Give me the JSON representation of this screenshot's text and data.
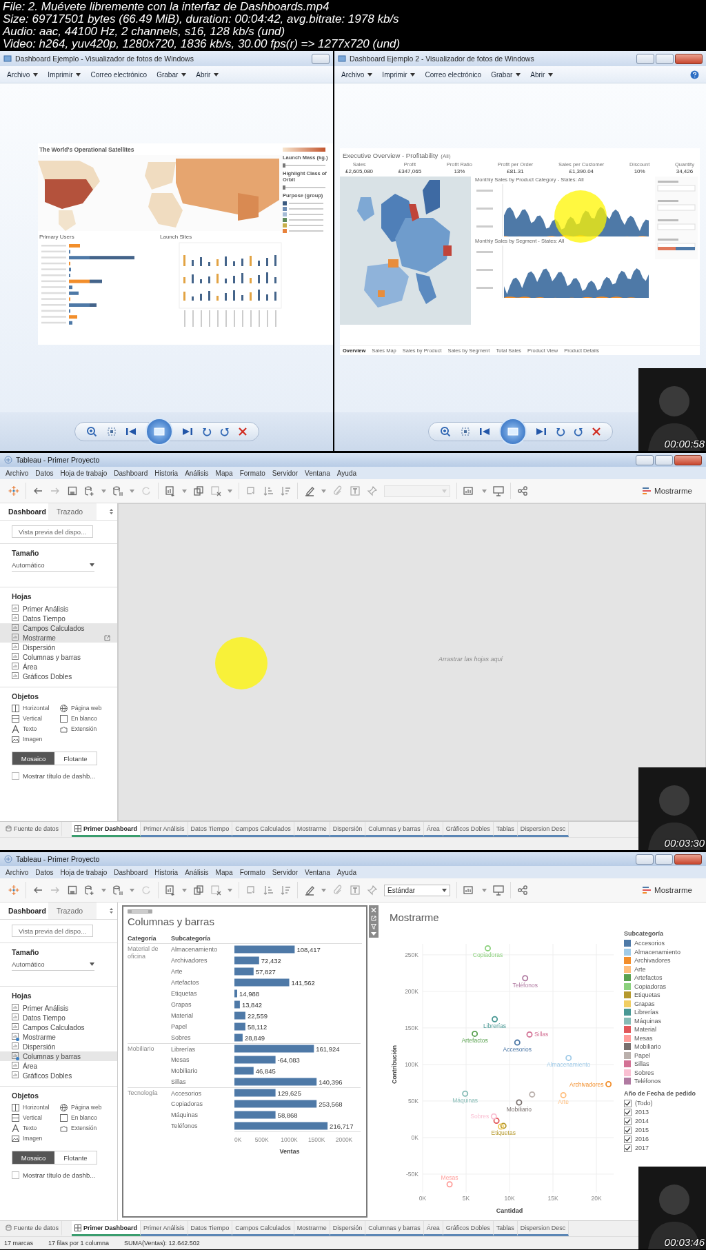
{
  "file_info": [
    "File: 2. Muévete libremente con la interfaz de Dashboards.mp4",
    "Size: 69717501 bytes (66.49 MiB), duration: 00:04:42, avg.bitrate: 1978 kb/s",
    "Audio: aac, 44100 Hz, 2 channels, s16, 128 kb/s (und)",
    "Video: h264, yuv420p, 1280x720, 1836 kb/s, 30.00 fps(r) => 1277x720 (und)"
  ],
  "frames": [
    {
      "kind": "photo_viewers",
      "timestamp": "00:00:58",
      "cursor_highlight": true,
      "windows": [
        {
          "title": "Dashboard Ejemplo - Visualizador de fotos de Windows",
          "buttons": [
            {
              "kind": "minimize"
            }
          ],
          "help": false,
          "menu": [
            {
              "label": "Archivo",
              "dropdown": true
            },
            {
              "label": "Imprimir",
              "dropdown": true
            },
            {
              "label": "Correo electrónico",
              "dropdown": false
            },
            {
              "label": "Grabar",
              "dropdown": true
            },
            {
              "label": "Abrir",
              "dropdown": true
            }
          ],
          "dashboard": {
            "kind": "satellites",
            "title": "The World's Operational Satellites",
            "legend_headings": [
              "Launch Mass (kg.)",
              "Highlight Class of Orbit",
              "Purpose (group)"
            ],
            "sections": [
              "Primary Users",
              "Launch Sites"
            ]
          }
        },
        {
          "title": "Dashboard Ejemplo 2 - Visualizador de fotos de Windows",
          "buttons": [
            {
              "kind": "minimize"
            },
            {
              "kind": "maximize"
            },
            {
              "kind": "close"
            }
          ],
          "help": true,
          "menu": [
            {
              "label": "Archivo",
              "dropdown": true
            },
            {
              "label": "Imprimir",
              "dropdown": true
            },
            {
              "label": "Correo electrónico",
              "dropdown": false
            },
            {
              "label": "Grabar",
              "dropdown": true
            },
            {
              "label": "Abrir",
              "dropdown": true
            }
          ],
          "dashboard": {
            "kind": "profitability",
            "title": "Executive Overview - Profitability",
            "filter": "(All)",
            "kpis": [
              {
                "label": "Sales",
                "value": "£2,605,080"
              },
              {
                "label": "Profit",
                "value": "£347,065"
              },
              {
                "label": "Profit Ratio",
                "value": "13%"
              },
              {
                "label": "Profit per Order",
                "value": "£81.31"
              },
              {
                "label": "Sales per Customer",
                "value": "£1,390.04"
              },
              {
                "label": "Discount",
                "value": "10%"
              },
              {
                "label": "Quantity",
                "value": "34,426"
              }
            ],
            "charts": [
              "Monthly Sales by Product Category - States: All",
              "Monthly Sales by Segment - States: All"
            ],
            "tabs": [
              {
                "label": "Overview",
                "selected": true
              },
              {
                "label": "Sales Map",
                "selected": false
              },
              {
                "label": "Sales by Product",
                "selected": false
              },
              {
                "label": "Sales by Segment",
                "selected": false
              },
              {
                "label": "Total Sales",
                "selected": false
              },
              {
                "label": "Product View",
                "selected": false
              },
              {
                "label": "Product Details",
                "selected": false
              }
            ]
          }
        }
      ]
    },
    {
      "kind": "tableau",
      "timestamp": "00:03:30",
      "cursor_highlight": true,
      "window": {
        "title": "Tableau - Primer Proyecto",
        "menu": [
          "Archivo",
          "Datos",
          "Hoja de trabajo",
          "Dashboard",
          "Historia",
          "Análisis",
          "Mapa",
          "Formato",
          "Servidor",
          "Ventana",
          "Ayuda"
        ],
        "toolbar": {
          "fit_field": {
            "disabled": true
          },
          "show_me": "Mostrarme"
        },
        "sidebar": {
          "tabs": [
            {
              "label": "Dashboard",
              "selected": true
            },
            {
              "label": "Trazado",
              "selected": false
            }
          ],
          "preview_button": "Vista previa del dispo...",
          "size_heading": "Tamaño",
          "size_value": "Automático",
          "sheets_heading": "Hojas",
          "sheets": [
            {
              "label": "Primer Análisis",
              "highlighted": false,
              "in_use": false,
              "open_icon": false
            },
            {
              "label": "Datos Tiempo",
              "highlighted": false,
              "in_use": false,
              "open_icon": false
            },
            {
              "label": "Campos Calculados",
              "highlighted": true,
              "in_use": false,
              "open_icon": false
            },
            {
              "label": "Mostrarme",
              "highlighted": true,
              "in_use": false,
              "open_icon": true
            },
            {
              "label": "Dispersión",
              "highlighted": false,
              "in_use": false,
              "open_icon": false
            },
            {
              "label": "Columnas y barras",
              "highlighted": false,
              "in_use": false,
              "open_icon": false
            },
            {
              "label": "Área",
              "highlighted": false,
              "in_use": false,
              "open_icon": false
            },
            {
              "label": "Gráficos Dobles",
              "highlighted": false,
              "in_use": false,
              "open_icon": false
            }
          ],
          "objects_heading": "Objetos",
          "objects": [
            {
              "kind": "horizontal",
              "label": "Horizontal"
            },
            {
              "kind": "webpage",
              "label": "Página web"
            },
            {
              "kind": "vertical",
              "label": "Vertical"
            },
            {
              "kind": "blank",
              "label": "En blanco"
            },
            {
              "kind": "text",
              "label": "Texto"
            },
            {
              "kind": "extension",
              "label": "Extensión"
            },
            {
              "kind": "image",
              "label": "Imagen"
            }
          ],
          "layout_modes": [
            {
              "label": "Mosaico",
              "selected": true
            },
            {
              "label": "Flotante",
              "selected": false
            }
          ],
          "show_title": {
            "label": "Mostrar título de dashb...",
            "checked": false
          }
        },
        "canvas": {
          "kind": "empty",
          "hint": "Arrastrar las hojas aquí"
        },
        "sheet_tabs": [
          {
            "kind": "datasource",
            "label": "Fuente de datos",
            "selected": false
          },
          {
            "kind": "dashboard",
            "label": "Primer Dashboard",
            "selected": true
          },
          {
            "kind": "worksheet",
            "label": "Primer Análisis",
            "selected": false
          },
          {
            "kind": "worksheet",
            "label": "Datos Tiempo",
            "selected": false
          },
          {
            "kind": "worksheet",
            "label": "Campos Calculados",
            "selected": false
          },
          {
            "kind": "worksheet",
            "label": "Mostrarme",
            "selected": false
          },
          {
            "kind": "worksheet",
            "label": "Dispersión",
            "selected": false
          },
          {
            "kind": "worksheet",
            "label": "Columnas y barras",
            "selected": false
          },
          {
            "kind": "worksheet",
            "label": "Área",
            "selected": false
          },
          {
            "kind": "worksheet",
            "label": "Gráficos Dobles",
            "selected": false
          },
          {
            "kind": "worksheet",
            "label": "Tablas",
            "selected": false
          },
          {
            "kind": "worksheet",
            "label": "Dispersion Desc",
            "selected": false
          }
        ]
      }
    },
    {
      "kind": "tableau",
      "timestamp": "00:03:46",
      "window": {
        "title": "Tableau - Primer Proyecto",
        "menu": [
          "Archivo",
          "Datos",
          "Hoja de trabajo",
          "Dashboard",
          "Historia",
          "Análisis",
          "Mapa",
          "Formato",
          "Servidor",
          "Ventana",
          "Ayuda"
        ],
        "toolbar": {
          "fit_field": {
            "value": "Estándar",
            "disabled": false
          },
          "show_me": "Mostrarme"
        },
        "sidebar": {
          "tabs": [
            {
              "label": "Dashboard",
              "selected": true
            },
            {
              "label": "Trazado",
              "selected": false
            }
          ],
          "preview_button": "Vista previa del dispo...",
          "size_heading": "Tamaño",
          "size_value": "Automático",
          "sheets_heading": "Hojas",
          "sheets": [
            {
              "label": "Primer Análisis",
              "highlighted": false,
              "in_use": false,
              "open_icon": false
            },
            {
              "label": "Datos Tiempo",
              "highlighted": false,
              "in_use": false,
              "open_icon": false
            },
            {
              "label": "Campos Calculados",
              "highlighted": false,
              "in_use": false,
              "open_icon": false
            },
            {
              "label": "Mostrarme",
              "highlighted": false,
              "in_use": true,
              "open_icon": false
            },
            {
              "label": "Dispersión",
              "highlighted": false,
              "in_use": false,
              "open_icon": false
            },
            {
              "label": "Columnas y barras",
              "highlighted": true,
              "in_use": true,
              "open_icon": false
            },
            {
              "label": "Área",
              "highlighted": false,
              "in_use": false,
              "open_icon": false
            },
            {
              "label": "Gráficos Dobles",
              "highlighted": false,
              "in_use": false,
              "open_icon": false
            }
          ],
          "objects_heading": "Objetos",
          "objects": [
            {
              "kind": "horizontal",
              "label": "Horizontal"
            },
            {
              "kind": "webpage",
              "label": "Página web"
            },
            {
              "kind": "vertical",
              "label": "Vertical"
            },
            {
              "kind": "blank",
              "label": "En blanco"
            },
            {
              "kind": "text",
              "label": "Texto"
            },
            {
              "kind": "extension",
              "label": "Extensión"
            },
            {
              "kind": "image",
              "label": "Imagen"
            }
          ],
          "layout_modes": [
            {
              "label": "Mosaico",
              "selected": true
            },
            {
              "label": "Flotante",
              "selected": false
            }
          ],
          "show_title": {
            "label": "Mostrar título de dashb...",
            "checked": false
          }
        },
        "canvas": {
          "kind": "dashboard",
          "zones": [
            {
              "kind": "bar_table",
              "title": "Columnas y barras",
              "selected": true,
              "headers": [
                "Categoría",
                "Subcategoría"
              ],
              "groups": [
                {
                  "label": "Material de oficina",
                  "value_labels": [
                    "108,417",
                    "72,432",
                    "57,827",
                    "141,562",
                    "14,988",
                    "13,842",
                    "22,559",
                    "58,112",
                    "28,849"
                  ]
                },
                {
                  "label": "Mobiliario",
                  "value_labels": [
                    "161,924",
                    "-64,083",
                    "46,845",
                    "140,396"
                  ]
                },
                {
                  "label": "Tecnología",
                  "value_labels": [
                    "129,625",
                    "253,568",
                    "58,868",
                    "216,717"
                  ]
                }
              ],
              "chart_data": {
                "type": "bar",
                "orientation": "horizontal",
                "xlabel": "Ventas",
                "xlim": [
                  0,
                  2000000
                ],
                "grid": true,
                "xticks": [
                  {
                    "value": 0,
                    "label": "0K"
                  },
                  {
                    "value": 500000,
                    "label": "500K"
                  },
                  {
                    "value": 1000000,
                    "label": "1000K"
                  },
                  {
                    "value": 1500000,
                    "label": "1500K"
                  },
                  {
                    "value": 2000000,
                    "label": "2000K"
                  }
                ],
                "categories": [
                  "Almacenamiento",
                  "Archivadores",
                  "Arte",
                  "Artefactos",
                  "Etiquetas",
                  "Grapas",
                  "Material",
                  "Papel",
                  "Sobres",
                  "Librerías",
                  "Mesas",
                  "Mobiliario",
                  "Sillas",
                  "Accesorios",
                  "Copiadoras",
                  "Máquinas",
                  "Teléfonos"
                ],
                "values": [
                  1100000,
                  450000,
                  350000,
                  1000000,
                  50000,
                  100000,
                  200000,
                  200000,
                  150000,
                  1450000,
                  750000,
                  350000,
                  1500000,
                  750000,
                  1500000,
                  750000,
                  1700000
                ]
              }
            },
            {
              "kind": "scatter",
              "title": "Mostrarme",
              "chart_data": {
                "type": "scatter",
                "xlabel": "Cantidad",
                "ylabel": "Contribución",
                "xlim": [
                  0,
                  22000
                ],
                "ylim": [
                  -75000,
                  265000
                ],
                "grid": true,
                "xticks": [
                  {
                    "value": 0,
                    "label": "0K"
                  },
                  {
                    "value": 5000,
                    "label": "5K"
                  },
                  {
                    "value": 10000,
                    "label": "10K"
                  },
                  {
                    "value": 15000,
                    "label": "15K"
                  },
                  {
                    "value": 20000,
                    "label": "20K"
                  }
                ],
                "yticks": [
                  {
                    "value": -50000,
                    "label": "-50K"
                  },
                  {
                    "value": 0,
                    "label": "0K"
                  },
                  {
                    "value": 50000,
                    "label": "50K"
                  },
                  {
                    "value": 100000,
                    "label": "100K"
                  },
                  {
                    "value": 150000,
                    "label": "150K"
                  },
                  {
                    "value": 200000,
                    "label": "200K"
                  },
                  {
                    "value": 250000,
                    "label": "250K"
                  }
                ],
                "series": [
                  {
                    "name": "Accesorios",
                    "color": "#4e79a7",
                    "x": [
                      10900
                    ],
                    "values": [
                      130000
                    ]
                  },
                  {
                    "name": "Almacenamiento",
                    "color": "#a0cbe8",
                    "x": [
                      16800
                    ],
                    "values": [
                      109000
                    ]
                  },
                  {
                    "name": "Archivadores",
                    "color": "#f28e2b",
                    "x": [
                      21400
                    ],
                    "values": [
                      73000
                    ]
                  },
                  {
                    "name": "Arte",
                    "color": "#ffbe7d",
                    "x": [
                      16200
                    ],
                    "values": [
                      58000
                    ]
                  },
                  {
                    "name": "Artefactos",
                    "color": "#59a14f",
                    "x": [
                      6000
                    ],
                    "values": [
                      142000
                    ]
                  },
                  {
                    "name": "Copiadoras",
                    "color": "#8cd17d",
                    "x": [
                      7500
                    ],
                    "values": [
                      259000
                    ]
                  },
                  {
                    "name": "Etiquetas",
                    "color": "#b6992d",
                    "x": [
                      9300
                    ],
                    "values": [
                      16000
                    ]
                  },
                  {
                    "color": "#f1ce63",
                    "x": [
                      9000
                    ],
                    "values": [
                      15000
                    ]
                  },
                  {
                    "name": "Librerías",
                    "color": "#499894",
                    "x": [
                      8300
                    ],
                    "values": [
                      162000
                    ]
                  },
                  {
                    "name": "Máquinas",
                    "color": "#86bcb6",
                    "x": [
                      4900
                    ],
                    "values": [
                      60000
                    ]
                  },
                  {
                    "color": "#e15759",
                    "x": [
                      8500
                    ],
                    "values": [
                      23000
                    ]
                  },
                  {
                    "name": "Mesas",
                    "color": "#ff9d9a",
                    "x": [
                      3100
                    ],
                    "values": [
                      -64000
                    ]
                  },
                  {
                    "name": "Mobiliario",
                    "color": "#79706e",
                    "x": [
                      11100
                    ],
                    "values": [
                      48000
                    ]
                  },
                  {
                    "color": "#bab0ac",
                    "x": [
                      12600
                    ],
                    "values": [
                      59000
                    ]
                  },
                  {
                    "name": "Sillas",
                    "color": "#d37295",
                    "x": [
                      12300
                    ],
                    "values": [
                      141000
                    ]
                  },
                  {
                    "name": "Sobres",
                    "color": "#fabfd2",
                    "x": [
                      8200
                    ],
                    "values": [
                      29000
                    ]
                  },
                  {
                    "name": "Teléfonos",
                    "color": "#b07aa1",
                    "x": [
                      11800
                    ],
                    "values": [
                      218000
                    ]
                  }
                ]
              },
              "legend": {
                "title": "Subcategoría",
                "items": [
                  {
                    "label": "Accesorios",
                    "color": "#4e79a7"
                  },
                  {
                    "label": "Almacenamiento",
                    "color": "#a0cbe8"
                  },
                  {
                    "label": "Archivadores",
                    "color": "#f28e2b"
                  },
                  {
                    "label": "Arte",
                    "color": "#ffbe7d"
                  },
                  {
                    "label": "Artefactos",
                    "color": "#59a14f"
                  },
                  {
                    "label": "Copiadoras",
                    "color": "#8cd17d"
                  },
                  {
                    "label": "Etiquetas",
                    "color": "#b6992d"
                  },
                  {
                    "label": "Grapas",
                    "color": "#f1ce63"
                  },
                  {
                    "label": "Librerías",
                    "color": "#499894"
                  },
                  {
                    "label": "Máquinas",
                    "color": "#86bcb6"
                  },
                  {
                    "label": "Material",
                    "color": "#e15759"
                  },
                  {
                    "label": "Mesas",
                    "color": "#ff9d9a"
                  },
                  {
                    "label": "Mobiliario",
                    "color": "#79706e"
                  },
                  {
                    "label": "Papel",
                    "color": "#bab0ac"
                  },
                  {
                    "label": "Sillas",
                    "color": "#d37295"
                  },
                  {
                    "label": "Sobres",
                    "color": "#fabfd2"
                  },
                  {
                    "label": "Teléfonos",
                    "color": "#b07aa1"
                  }
                ]
              },
              "filter": {
                "title": "Año de Fecha de pedido",
                "options": [
                  {
                    "label": "(Todo)",
                    "checked": true
                  },
                  {
                    "label": "2013",
                    "checked": true
                  },
                  {
                    "label": "2014",
                    "checked": true
                  },
                  {
                    "label": "2015",
                    "checked": true
                  },
                  {
                    "label": "2016",
                    "checked": true
                  },
                  {
                    "label": "2017",
                    "checked": true
                  }
                ]
              }
            }
          ]
        },
        "sheet_tabs": [
          {
            "kind": "datasource",
            "label": "Fuente de datos",
            "selected": false
          },
          {
            "kind": "dashboard",
            "label": "Primer Dashboard",
            "selected": true
          },
          {
            "kind": "worksheet",
            "label": "Primer Análisis",
            "selected": false
          },
          {
            "kind": "worksheet",
            "label": "Datos Tiempo",
            "selected": false
          },
          {
            "kind": "worksheet",
            "label": "Campos Calculados",
            "selected": false
          },
          {
            "kind": "worksheet",
            "label": "Mostrarme",
            "selected": false
          },
          {
            "kind": "worksheet",
            "label": "Dispersión",
            "selected": false
          },
          {
            "kind": "worksheet",
            "label": "Columnas y barras",
            "selected": false
          },
          {
            "kind": "worksheet",
            "label": "Área",
            "selected": false
          },
          {
            "kind": "worksheet",
            "label": "Gráficos Dobles",
            "selected": false
          },
          {
            "kind": "worksheet",
            "label": "Tablas",
            "selected": false
          },
          {
            "kind": "worksheet",
            "label": "Dispersion Desc",
            "selected": false
          }
        ],
        "status": [
          "17 marcas",
          "17 filas por 1 columna",
          "SUMA(Ventas): 12.642.502"
        ]
      }
    }
  ]
}
